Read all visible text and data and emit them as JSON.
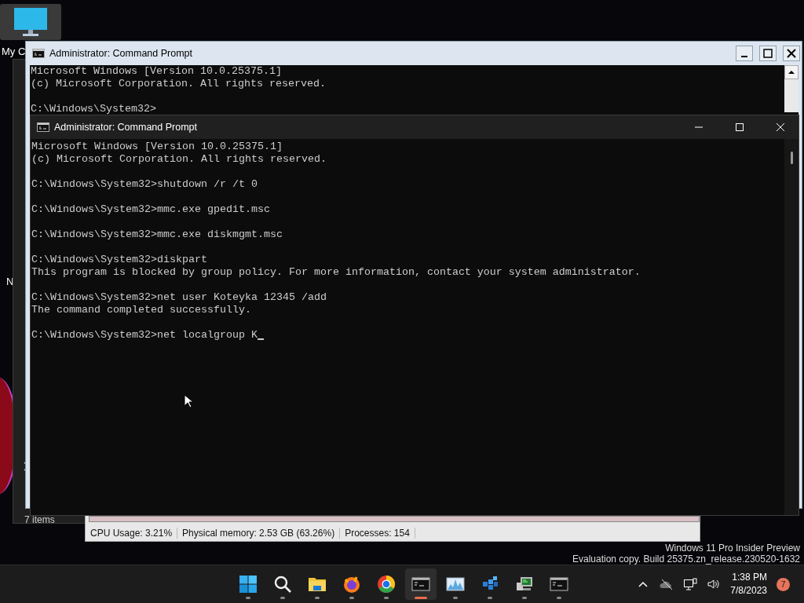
{
  "desktop_icons": [
    {
      "label": "My C"
    },
    {
      "label": "N"
    }
  ],
  "explorer": {
    "status": "7 items"
  },
  "task_manager": {
    "status_bar": [
      "CPU Usage: 3.21%",
      "Physical memory: 2.53 GB (63.26%)",
      "Processes: 154"
    ]
  },
  "windows": [
    {
      "kind": "classic",
      "title": "Administrator:  Command Prompt",
      "blocks": [
        [
          "Microsoft Windows [Version 10.0.25375.1]",
          "(c) Microsoft Corporation. All rights reserved."
        ],
        [
          "C:\\Windows\\System32>"
        ]
      ]
    },
    {
      "kind": "modern",
      "title": "Administrator:  Command Prompt",
      "blocks": [
        [
          "Microsoft Windows [Version 10.0.25375.1]",
          "(c) Microsoft Corporation. All rights reserved."
        ],
        [
          "C:\\Windows\\System32>shutdown /r /t 0"
        ],
        [
          "C:\\Windows\\System32>mmc.exe gpedit.msc"
        ],
        [
          "C:\\Windows\\System32>mmc.exe diskmgmt.msc"
        ],
        [
          "C:\\Windows\\System32>diskpart",
          "This program is blocked by group policy. For more information, contact your system administrator."
        ],
        [
          "C:\\Windows\\System32>net user Koteyka 12345 /add",
          "The command completed successfully."
        ],
        [
          "C:\\Windows\\System32>net localgroup K"
        ]
      ],
      "cursor": true
    }
  ],
  "watermark": [
    "Windows 11 Pro Insider Preview",
    "Evaluation copy. Build 25375.zn_release.230520-1632"
  ],
  "taskbar": {
    "apps": [
      {
        "kind": "start",
        "selected": false
      },
      {
        "kind": "search",
        "selected": false
      },
      {
        "kind": "folder",
        "selected": false
      },
      {
        "kind": "fox",
        "selected": false
      },
      {
        "kind": "ring",
        "selected": false
      },
      {
        "kind": "terminal",
        "selected": true
      },
      {
        "kind": "chart",
        "selected": false
      },
      {
        "kind": "cubes",
        "selected": false
      },
      {
        "kind": "monitor",
        "selected": false
      },
      {
        "kind": "terminal",
        "selected": false
      }
    ],
    "time": "1:38 PM",
    "date": "7/8/2023",
    "notifications": "7"
  }
}
